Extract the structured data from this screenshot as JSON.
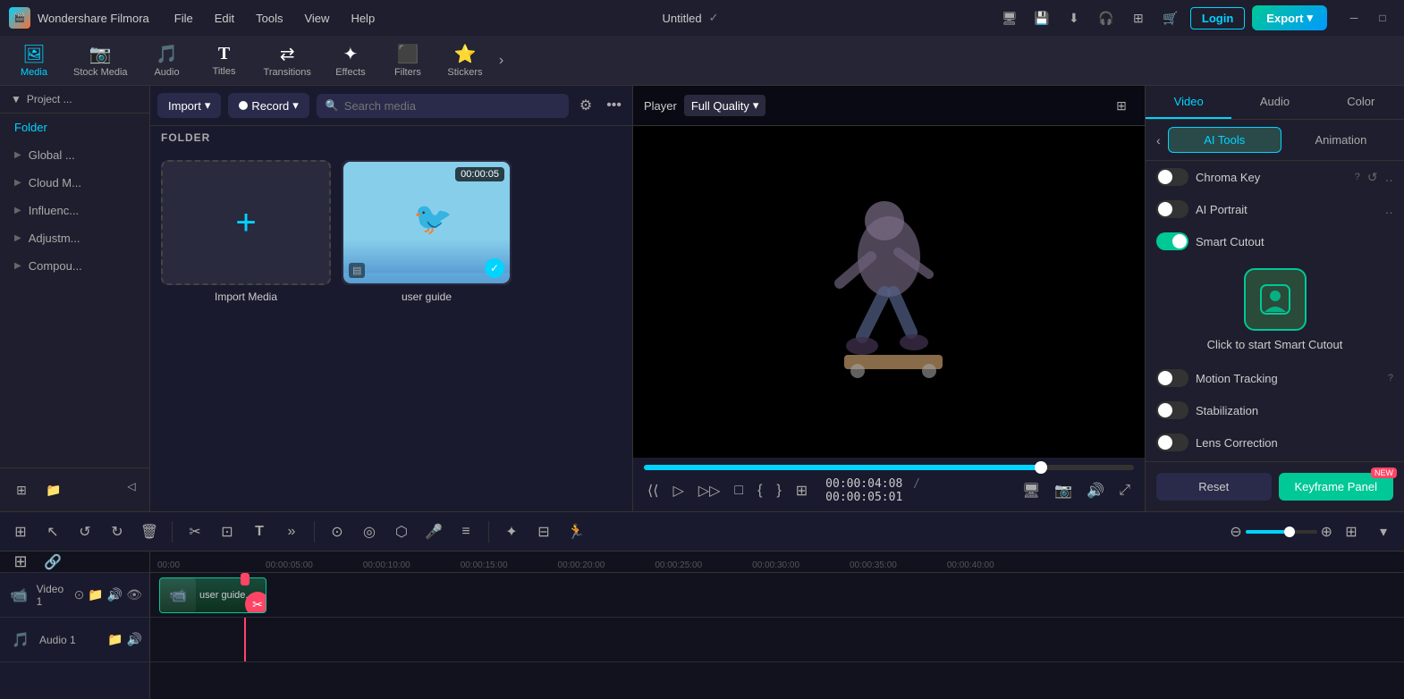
{
  "app": {
    "name": "Wondershare Filmora",
    "project_title": "Untitled"
  },
  "title_bar": {
    "menu_items": [
      "File",
      "Edit",
      "Tools",
      "View",
      "Help"
    ],
    "login_label": "Login",
    "export_label": "Export"
  },
  "toolbar": {
    "items": [
      {
        "id": "media",
        "icon": "🖼",
        "label": "Media",
        "active": true
      },
      {
        "id": "stock_media",
        "icon": "📹",
        "label": "Stock Media",
        "active": false
      },
      {
        "id": "audio",
        "icon": "🎵",
        "label": "Audio",
        "active": false
      },
      {
        "id": "titles",
        "icon": "T",
        "label": "Titles",
        "active": false
      },
      {
        "id": "transitions",
        "icon": "↔",
        "label": "Transitions",
        "active": false
      },
      {
        "id": "effects",
        "icon": "✨",
        "label": "Effects",
        "active": false
      },
      {
        "id": "filters",
        "icon": "🔲",
        "label": "Filters",
        "active": false
      },
      {
        "id": "stickers",
        "icon": "⭐",
        "label": "Stickers",
        "active": false
      }
    ]
  },
  "left_panel": {
    "header": "Project ...",
    "active_item": "Folder",
    "items": [
      {
        "label": "Folder",
        "active": true
      },
      {
        "label": "Global ...",
        "active": false
      },
      {
        "label": "Cloud M...",
        "active": false
      },
      {
        "label": "Influenc...",
        "active": false
      },
      {
        "label": "Adjustm...",
        "active": false
      },
      {
        "label": "Compou...",
        "active": false
      }
    ]
  },
  "media_panel": {
    "import_label": "Import",
    "record_label": "Record",
    "search_placeholder": "Search media",
    "folder_label": "FOLDER",
    "media_items": [
      {
        "type": "add",
        "label": "Import Media"
      },
      {
        "type": "video",
        "label": "user guide",
        "duration": "00:00:05",
        "checked": true
      }
    ]
  },
  "player": {
    "label": "Player",
    "quality": "Full Quality",
    "current_time": "00:00:04:08",
    "total_time": "00:00:05:01",
    "progress_pct": 82
  },
  "right_panel": {
    "tabs": [
      "Video",
      "Audio",
      "Color"
    ],
    "active_tab": "Video",
    "sub_tabs": [
      "AI Tools",
      "Animation"
    ],
    "active_sub_tab": "AI Tools",
    "toggles": [
      {
        "label": "Chroma Key",
        "on": false,
        "has_question": true
      },
      {
        "label": "AI Portrait",
        "on": false,
        "has_question": false
      },
      {
        "label": "Smart Cutout",
        "on": true,
        "type": "green",
        "has_question": false
      }
    ],
    "smart_cutout_label": "Click to start Smart Cutout",
    "motion_tracking": {
      "label": "Motion Tracking",
      "on": false,
      "has_question": true
    },
    "stabilization": {
      "label": "Stabilization",
      "on": false
    },
    "lens_correction": {
      "label": "Lens Correction",
      "on": false
    },
    "reset_label": "Reset",
    "keyframe_label": "Keyframe Panel",
    "new_badge": "NEW"
  },
  "timeline": {
    "tracks": [
      {
        "name": "Video 1",
        "type": "video"
      },
      {
        "name": "Audio 1",
        "type": "audio"
      }
    ],
    "ruler_ticks": [
      "00:00",
      "00:00:05:00",
      "00:00:10:00",
      "00:00:15:00",
      "00:00:20:00",
      "00:00:25:00",
      "00:00:30:00",
      "00:00:35:00",
      "00:00:40:00"
    ],
    "clip_label": "user guide..."
  }
}
